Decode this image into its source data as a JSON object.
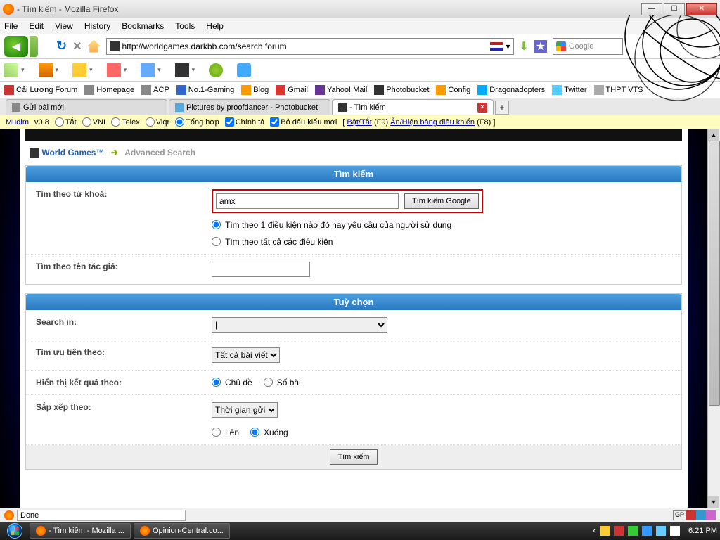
{
  "window": {
    "title": "- Tìm kiếm - Mozilla Firefox"
  },
  "menu": {
    "file": "File",
    "edit": "Edit",
    "view": "View",
    "history": "History",
    "bookmarks": "Bookmarks",
    "tools": "Tools",
    "help": "Help"
  },
  "url": "http://worldgames.darkbb.com/search.forum",
  "searchbox": {
    "placeholder": "Google"
  },
  "bookmarks": [
    {
      "label": "Cải Lương Forum"
    },
    {
      "label": "Homepage"
    },
    {
      "label": "ACP"
    },
    {
      "label": "No.1-Gaming"
    },
    {
      "label": "Blog"
    },
    {
      "label": "Gmail"
    },
    {
      "label": "Yahoo! Mail"
    },
    {
      "label": "Photobucket"
    },
    {
      "label": "Config"
    },
    {
      "label": "Dragonadopters"
    },
    {
      "label": "Twitter"
    },
    {
      "label": "THPT VTS"
    }
  ],
  "tabs": [
    {
      "label": "Gửi bài mới"
    },
    {
      "label": "Pictures by proofdancer - Photobucket"
    },
    {
      "label": "- Tìm kiếm"
    }
  ],
  "mudim": {
    "name": "Mudim",
    "ver": "v0.8",
    "tat": "Tắt",
    "vni": "VNI",
    "telex": "Telex",
    "viqr": "Viqr",
    "tonghop": "Tổng hợp",
    "chinhta": "Chính tả",
    "bodau": "Bỏ dấu kiểu mới",
    "toggle": "Bật/Tắt",
    "toggle_key": "(F9)",
    "panel": "Ẩn/Hiện bảng điều khiển",
    "panel_key": "(F8)"
  },
  "breadcrumb": {
    "site": "World Games™",
    "adv": "Advanced Search"
  },
  "search": {
    "header": "Tìm kiếm",
    "keyword_label": "Tìm theo từ khoá:",
    "keyword_value": "amx",
    "google_btn": "Tìm kiếm Google",
    "cond1": "Tìm theo 1 điều kiện nào đó hay yêu cầu của người sử dụng",
    "cond2": "Tìm theo tất cả các điều kiện",
    "author_label": "Tìm theo tên tác giả:"
  },
  "options": {
    "header": "Tuỳ chọn",
    "searchin_label": "Search in:",
    "priority_label": "Tìm ưu tiên theo:",
    "priority_value": "Tất cả bài viết",
    "display_label": "Hiển thị kết quả theo:",
    "display_topic": "Chủ đề",
    "display_count": "Số bài",
    "sort_label": "Sắp xếp theo:",
    "sort_value": "Thời gian gửi",
    "sort_asc": "Lên",
    "sort_desc": "Xuống",
    "submit": "Tìm kiếm"
  },
  "status": {
    "done": "Done",
    "gp": "GP"
  },
  "taskbar": {
    "t1": "- Tìm kiếm - Mozilla ...",
    "t2": "Opinion-Central.co...",
    "time": "6:21 PM"
  }
}
